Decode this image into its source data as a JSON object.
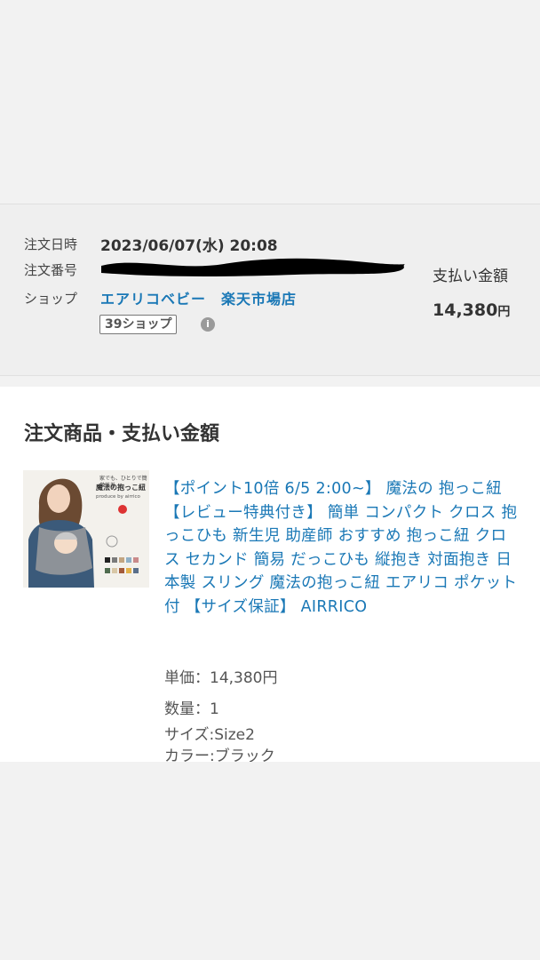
{
  "order": {
    "date_label": "注文日時",
    "date_value": "2023/06/07(水) 20:08",
    "number_label": "注文番号",
    "shop_label": "ショップ",
    "shop_name": "エアリコベビー　楽天市場店",
    "shop_badge": "39ショップ",
    "info_icon_glyph": "i",
    "total_label": "支払い金額",
    "total_amount": "14,380",
    "total_currency": "円"
  },
  "items": {
    "section_title": "注文商品・支払い金額",
    "product": {
      "title": "【ポイント10倍 6/5 2:00~】 魔法の 抱っこ紐 【レビュー特典付き】 簡単 コンパクト クロス 抱っこひも 新生児 助産師 おすすめ 抱っこ紐 クロス セカンド 簡易 だっこひも 縦抱き 対面抱き 日本製 スリング 魔法の抱っこ紐 エアリコ ポケット付 【サイズ保証】 AIRRICO",
      "unit_price": "単価：14,380円",
      "quantity": "数量：1",
      "size": "サイズ:Size2",
      "color": "カラー:ブラック",
      "thumb_caption_1": "家でも、ひとりで簡単装着",
      "thumb_caption_2": "魔法の抱っこ紐",
      "thumb_brand": "produce by airrico"
    }
  }
}
